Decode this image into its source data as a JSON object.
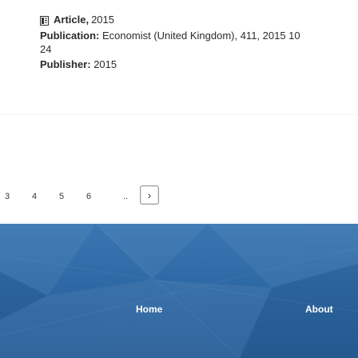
{
  "record": {
    "type": "Article,",
    "year": "2015",
    "publication_label": "Publication:",
    "publication_value": "Economist (United Kingdom), 411, 2015 10",
    "publication_tail": "24",
    "publisher_label": "Publisher:",
    "publisher_value": "2015"
  },
  "pagination": {
    "pages": [
      "3",
      "4",
      "5",
      "6"
    ],
    "ellipsis": "..",
    "next_label": "›"
  },
  "footer": {
    "links": [
      "Home",
      "About"
    ]
  },
  "colors": {
    "footer_bg": "#2e69a5",
    "text": "#2b2b2b"
  }
}
